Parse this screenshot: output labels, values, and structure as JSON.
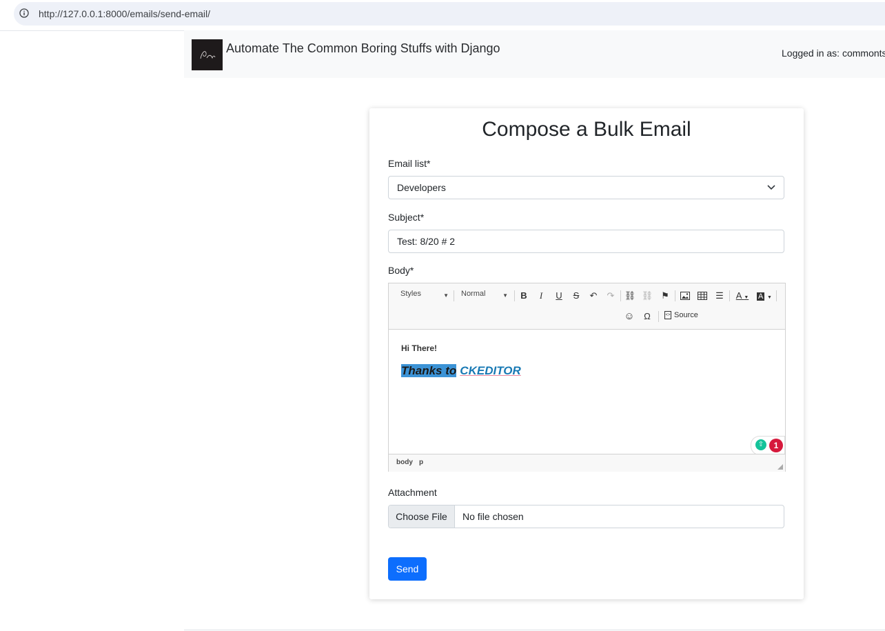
{
  "browser": {
    "url": "http://127.0.0.1:8000/emails/send-email/"
  },
  "navbar": {
    "title": "Automate The Common Boring Stuffs with Django",
    "logged_in": "Logged in as: commonts"
  },
  "form": {
    "heading": "Compose a Bulk Email",
    "email_list": {
      "label": "Email list*",
      "value": "Developers"
    },
    "subject": {
      "label": "Subject*",
      "value": "Test: 8/20 # 2"
    },
    "body": {
      "label": "Body*",
      "toolbar": {
        "styles": "Styles",
        "format": "Normal",
        "source": "Source"
      },
      "content": {
        "line1": "Hi There!",
        "highlighted": "Thanks to",
        "link": "CKEDITOR"
      },
      "path": [
        "body",
        "p"
      ],
      "issues_count": "1"
    },
    "attachment": {
      "label": "Attachment",
      "button": "Choose File",
      "status": "No file chosen"
    },
    "send_label": "Send"
  },
  "colors": {
    "primary": "#0d6efd",
    "selection": "#3c93d6",
    "link": "#1879b4",
    "badge": "#d6193c"
  }
}
